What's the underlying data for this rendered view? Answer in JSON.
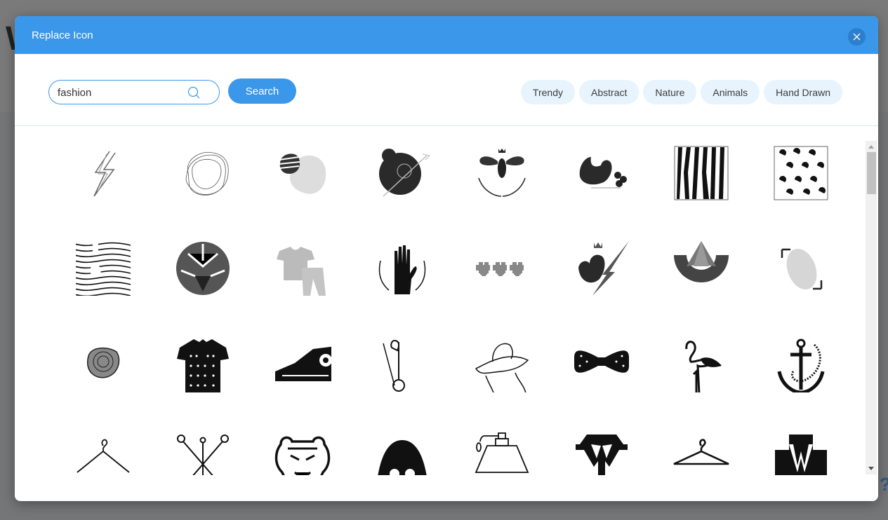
{
  "background": {
    "heading_fragment": "W",
    "help_glyph": "?"
  },
  "modal": {
    "title": "Replace Icon",
    "close_icon": "close-icon"
  },
  "search": {
    "value": "fashion",
    "placeholder": "",
    "icon": "search-icon",
    "button_label": "Search"
  },
  "tags": [
    {
      "label": "Trendy"
    },
    {
      "label": "Abstract"
    },
    {
      "label": "Nature"
    },
    {
      "label": "Animals"
    },
    {
      "label": "Hand Drawn"
    }
  ],
  "colors": {
    "accent": "#3a97ea",
    "close_bg": "#2c7fcb",
    "tag_bg": "#e8f4fd",
    "overlay": "#757575"
  },
  "icons": [
    {
      "name": "lightning-sketch-icon"
    },
    {
      "name": "wavy-rings-icon"
    },
    {
      "name": "striped-blob-icon"
    },
    {
      "name": "bird-arrow-badge-icon"
    },
    {
      "name": "queen-bee-wreath-icon"
    },
    {
      "name": "bird-berries-icon"
    },
    {
      "name": "zebra-pattern-icon"
    },
    {
      "name": "leopard-pattern-icon"
    },
    {
      "name": "op-art-waves-icon"
    },
    {
      "name": "geometric-tiger-icon"
    },
    {
      "name": "tshirt-pants-icon"
    },
    {
      "name": "hand-laurel-icon"
    },
    {
      "name": "pixel-hearts-icon"
    },
    {
      "name": "crowned-bird-lightning-icon"
    },
    {
      "name": "abstract-a-arc-icon"
    },
    {
      "name": "dotted-fingerprint-icon"
    },
    {
      "name": "rose-swirl-icon"
    },
    {
      "name": "polka-dot-polo-icon"
    },
    {
      "name": "high-top-sneaker-icon"
    },
    {
      "name": "safety-pin-icon"
    },
    {
      "name": "woman-sun-hat-icon"
    },
    {
      "name": "polka-bow-tie-icon"
    },
    {
      "name": "flamingo-icon"
    },
    {
      "name": "anchor-rope-icon"
    },
    {
      "name": "clothes-hanger-icon"
    },
    {
      "name": "crossed-pins-icon"
    },
    {
      "name": "tiger-head-icon"
    },
    {
      "name": "hooded-glasses-icon"
    },
    {
      "name": "perfume-bottle-icon"
    },
    {
      "name": "shirt-collar-icon"
    },
    {
      "name": "simple-hanger-icon"
    },
    {
      "name": "suit-lapel-icon"
    }
  ],
  "scrollbar": {
    "position_fraction": 0.0
  }
}
